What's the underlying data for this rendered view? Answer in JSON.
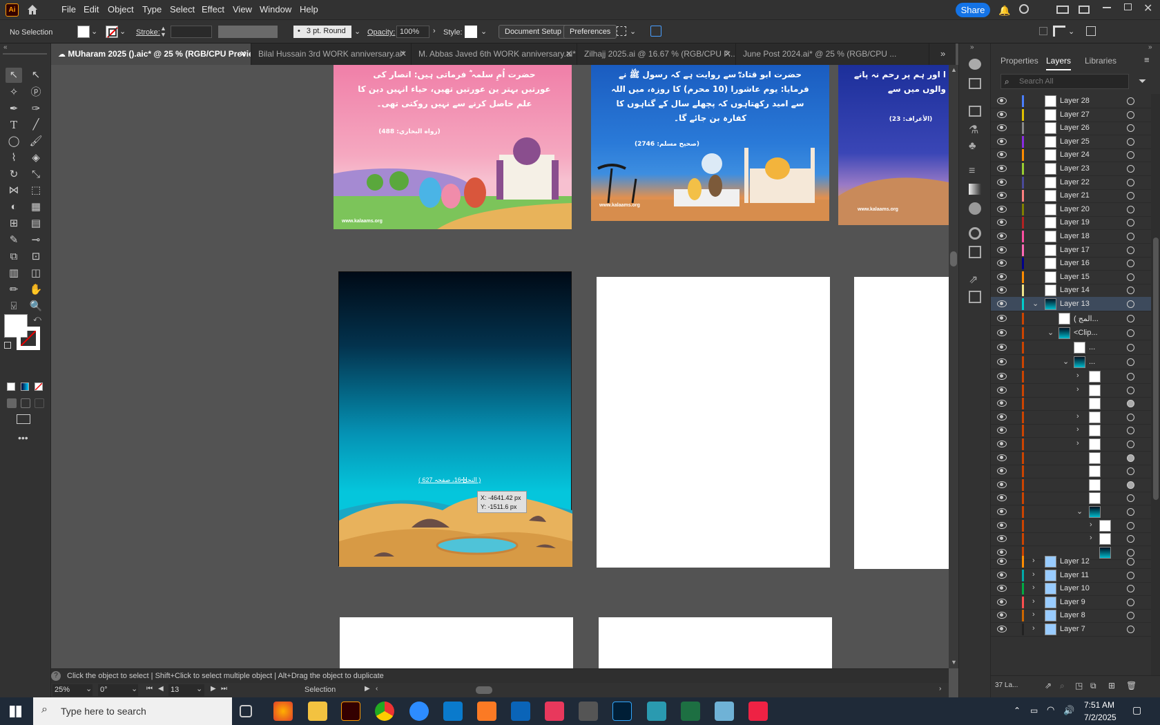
{
  "app": {
    "logo": "Ai",
    "accent": "#ff9a00",
    "share_label": "Share"
  },
  "menu": [
    "File",
    "Edit",
    "Object",
    "Type",
    "Select",
    "Effect",
    "View",
    "Window",
    "Help"
  ],
  "control": {
    "selection": "No Selection",
    "stroke_label": "Stroke:",
    "brush": "3 pt. Round",
    "opacity_label": "Opacity:",
    "opacity_value": "100%",
    "style_label": "Style:",
    "doc_setup": "Document Setup",
    "preferences": "Preferences"
  },
  "tabs": [
    {
      "label": "MUharam 2025 ().aic* @ 25 % (RGB/CPU Preview)",
      "active": true
    },
    {
      "label": "Bilal Hussain  3rd  WORK anniversary.ai*"
    },
    {
      "label": "M. Abbas Javed  6th  WORK anniversary.ai*"
    },
    {
      "label": "Zilhajj 2025.ai @ 16.67 % (RGB/CPU P..."
    },
    {
      "label": "June Post 2024.ai* @ 25 % (RGB/CPU ..."
    }
  ],
  "artboards": {
    "pink_text": "حضرت اُمِ سلمہ ؓ فرماتی ہیں: انصار کی عورتیں بہتر ین عورتیں تھیں، حیاء انہیں دین کا علم حاصل کرنے سے نہیں روکتی تھی۔",
    "pink_ref": "(رواه البخاري: 488)",
    "blue_text": "حضرت ابو قتادہؓ سے روایت ہے کہ رسول ﷺ نے فرمایا: یوم عاشورا (10 محرم) کا روزہ، میں اللہ سے امید رکھتاہوں کہ پچھلے سال کے گناہوں کا کفارہ بن جائے گا۔",
    "blue_ref": "(صحیح مسلم: 2746)",
    "purple_text": "ا اور ہم پر رحم نہ پانے والوں میں سے",
    "purple_ref": "(الأعراف: 23)",
    "website": "www.kalaams.org",
    "desert_ref": "( النحل 16، صفحہ 627 )"
  },
  "tooltip": {
    "x": "X: -4641.42 px",
    "y": "Y: -1511.6 px"
  },
  "panel": {
    "tabs": [
      "Properties",
      "Layers",
      "Libraries"
    ],
    "active_tab": "Layers",
    "search_placeholder": "Search All",
    "footer": "37 La..."
  },
  "layers_top": [
    "Layer 28",
    "Layer 27",
    "Layer 26",
    "Layer 25",
    "Layer 24",
    "Layer 23",
    "Layer 22",
    "Layer 21",
    "Layer 20",
    "Layer 19",
    "Layer 18",
    "Layer 17",
    "Layer 16",
    "Layer 15",
    "Layer 14"
  ],
  "layer_colors": [
    "#4a7fff",
    "#e0c000",
    "#888888",
    "#8a2be2",
    "#ff8c00",
    "#9acd32",
    "#4a4a9a",
    "#ff8080",
    "#808000",
    "#b22222",
    "#ff4fa0",
    "#ff69b4",
    "#00008b",
    "#ff8c00",
    "#f0e68c"
  ],
  "layer13": {
    "name": "Layer 13",
    "child1": "( المج...",
    "child2": "<Clip...",
    "child3": "..."
  },
  "layers_bottom": [
    "Layer 12",
    "Layer 11",
    "Layer 10",
    "Layer 9",
    "Layer 8",
    "Layer 7"
  ],
  "status": {
    "hint": "Click the object to select  |  Shift+Click to select multiple object  |  Alt+Drag the object to duplicate",
    "zoom": "25%",
    "rotate": "0°",
    "artboard": "13",
    "tool": "Selection"
  },
  "taskbar": {
    "search_placeholder": "Type here to search",
    "time": "7:51 AM",
    "date": "7/2/2025"
  }
}
